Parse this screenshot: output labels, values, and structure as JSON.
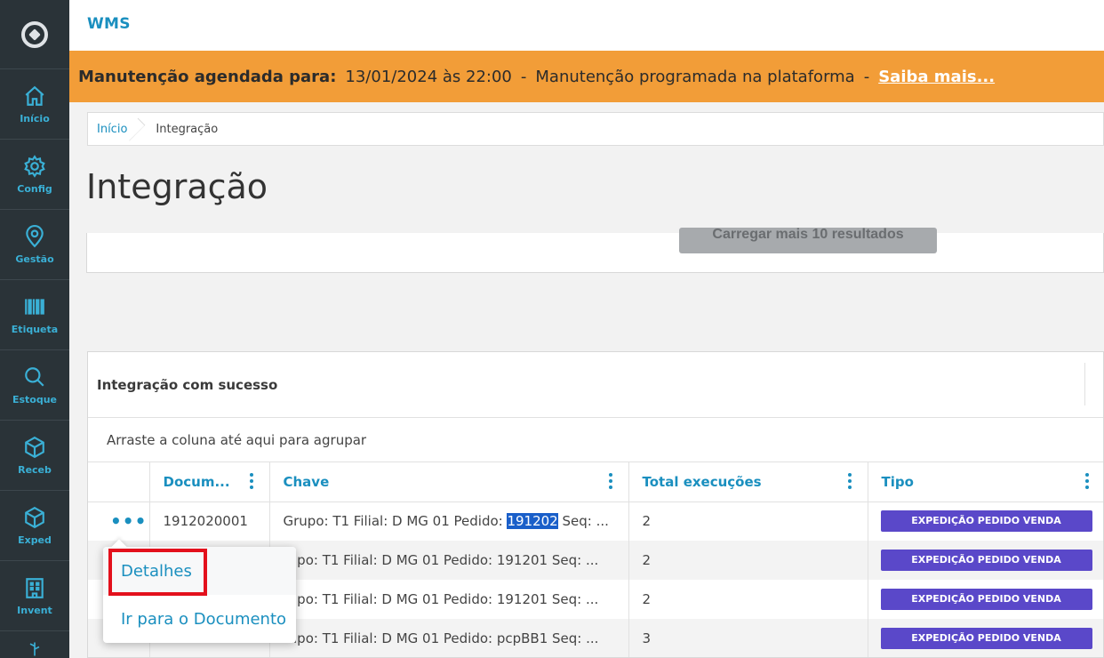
{
  "app": {
    "title": "WMS"
  },
  "sidebar": {
    "items": [
      {
        "label": "Início",
        "icon": "home-icon"
      },
      {
        "label": "Config",
        "icon": "gear-icon"
      },
      {
        "label": "Gestão",
        "icon": "map-pin-icon"
      },
      {
        "label": "Etiqueta",
        "icon": "barcode-icon"
      },
      {
        "label": "Estoque",
        "icon": "search-icon"
      },
      {
        "label": "Receb",
        "icon": "box-icon"
      },
      {
        "label": "Exped",
        "icon": "box-icon"
      },
      {
        "label": "Invent",
        "icon": "building-icon"
      }
    ]
  },
  "banner": {
    "label": "Manutenção agendada para:",
    "datetime": "13/01/2024 às 22:00",
    "separator": "-",
    "message": "Manutenção programada na plataforma",
    "link": "Saiba mais..."
  },
  "breadcrumb": {
    "home": "Início",
    "current": "Integração"
  },
  "page": {
    "title": "Integração"
  },
  "upper_card": {
    "load_more": "Carregar mais 10 resultados"
  },
  "main_card": {
    "title": "Integração com sucesso",
    "group_hint": "Arraste a coluna até aqui para agrupar",
    "columns": [
      "Docum...",
      "Chave",
      "Total execuções",
      "Tipo"
    ],
    "rows": [
      {
        "doc": "1912020001",
        "chave_prefix": "Grupo: T1 Filial: D MG 01 Pedido: ",
        "chave_highlight": "191202",
        "chave_suffix": " Seq: ...",
        "total": "2",
        "tipo": "EXPEDIÇÃO PEDIDO VENDA"
      },
      {
        "doc": "",
        "chave_prefix": "rupo: T1 Filial: D MG 01 Pedido: 191201 Seq: ...",
        "chave_highlight": "",
        "chave_suffix": "",
        "total": "2",
        "tipo": "EXPEDIÇÃO PEDIDO VENDA"
      },
      {
        "doc": "",
        "chave_prefix": "rupo: T1 Filial: D MG 01 Pedido: 191201 Seq: ...",
        "chave_highlight": "",
        "chave_suffix": "",
        "total": "2",
        "tipo": "EXPEDIÇÃO PEDIDO VENDA"
      },
      {
        "doc": "",
        "chave_prefix": "rupo: T1 Filial: D MG 01 Pedido: pcpBB1 Seq: ...",
        "chave_highlight": "",
        "chave_suffix": "",
        "total": "3",
        "tipo": "EXPEDIÇÃO PEDIDO VENDA"
      }
    ],
    "row_actions": "•••"
  },
  "context_menu": {
    "items": [
      "Detalhes",
      "Ir para o Documento"
    ]
  },
  "colors": {
    "sidebar": "#2a3338",
    "accent": "#1a8fbf",
    "banner": "#f29d38",
    "badge": "#5a48c9",
    "highlight_box": "#e3101c"
  }
}
